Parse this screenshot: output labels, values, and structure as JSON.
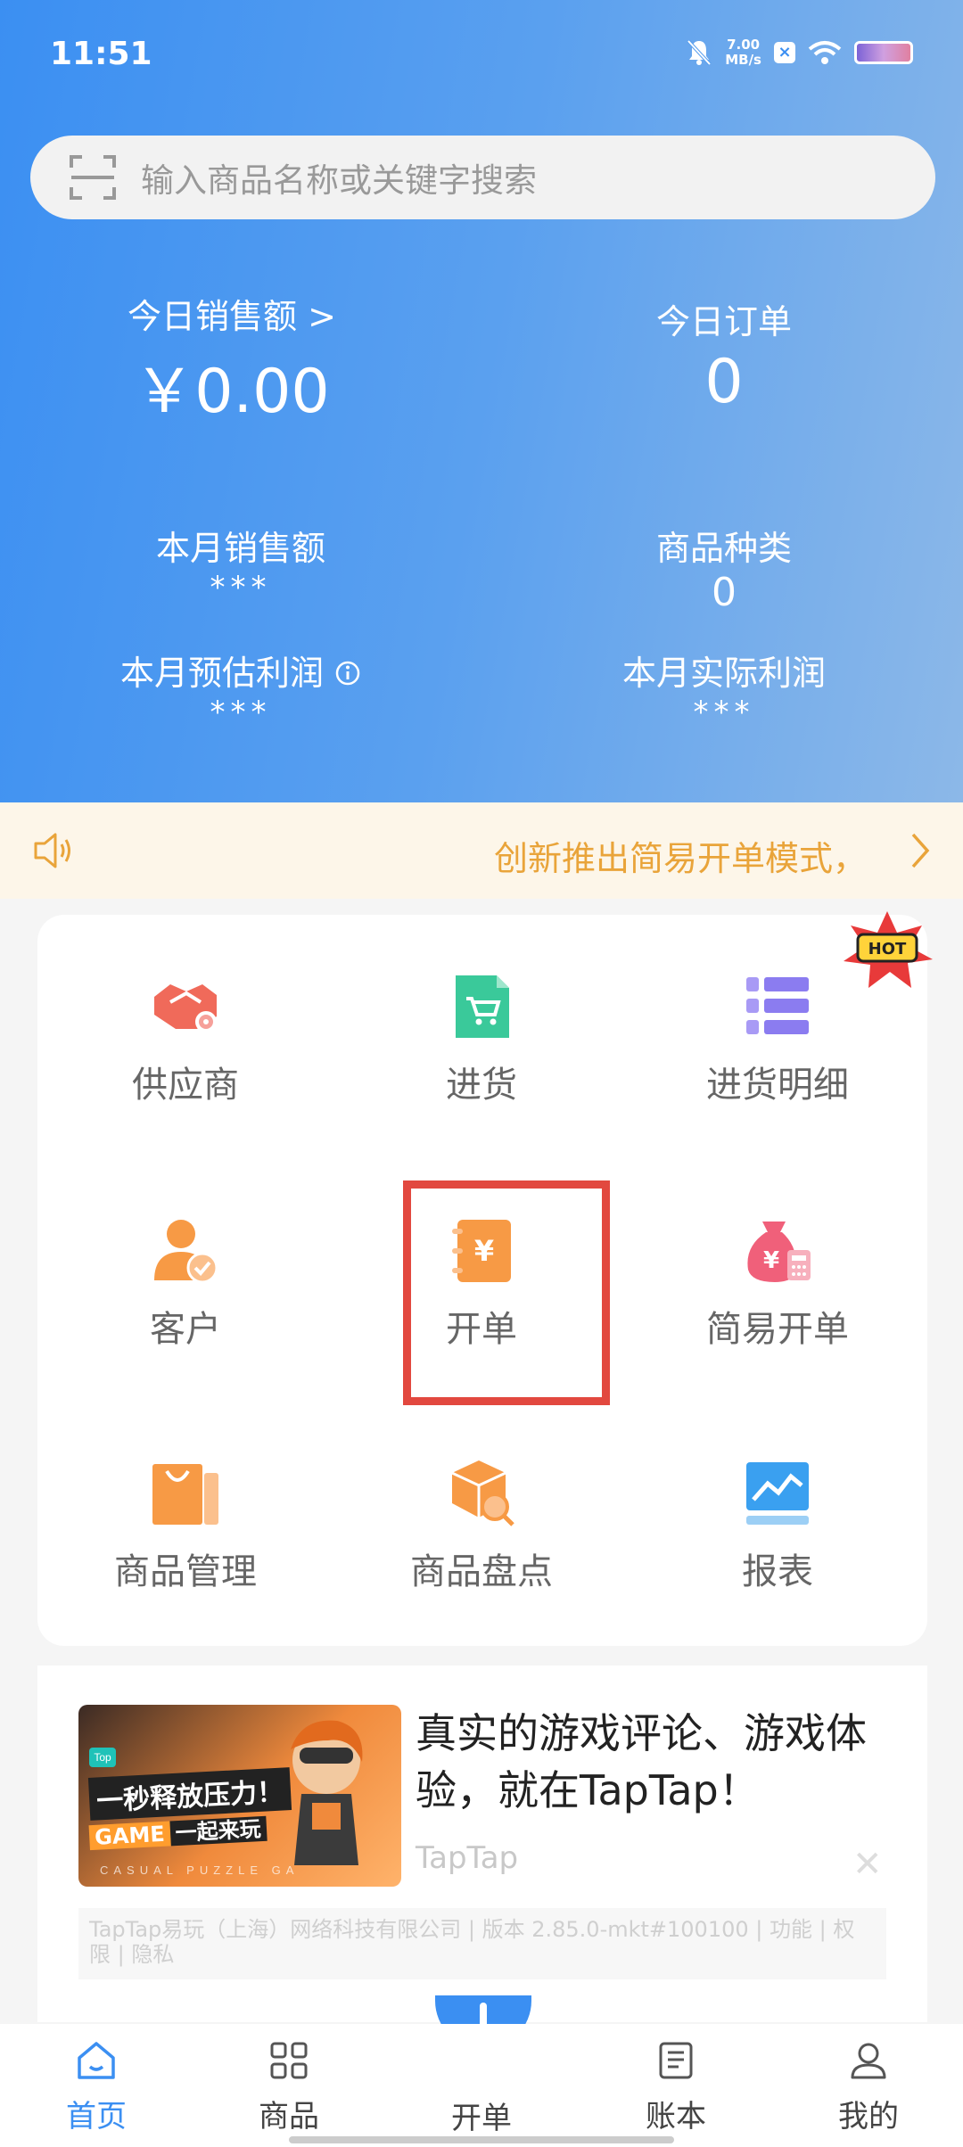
{
  "status_bar": {
    "time": "11:51",
    "net_speed_value": "7.00",
    "net_speed_unit": "MB/s"
  },
  "search": {
    "placeholder": "输入商品名称或关键字搜索"
  },
  "stats": {
    "today_sales_label": "今日销售额",
    "today_sales_arrow": ">",
    "today_sales_value": "￥0.00",
    "today_orders_label": "今日订单",
    "today_orders_value": "0",
    "month_sales_label": "本月销售额",
    "month_sales_value": "***",
    "product_types_label": "商品种类",
    "product_types_value": "0",
    "month_est_profit_label": "本月预估利润",
    "month_est_profit_value": "***",
    "month_actual_profit_label": "本月实际利润",
    "month_actual_profit_value": "***"
  },
  "notice": {
    "text": "创新推出简易开单模式，"
  },
  "grid": {
    "items": [
      {
        "label": "供应商",
        "icon": "handshake-icon",
        "color": "#f06a5a"
      },
      {
        "label": "进货",
        "icon": "cart-doc-icon",
        "color": "#3ac99a"
      },
      {
        "label": "进货明细",
        "icon": "list-icon",
        "color": "#8b7cf0"
      },
      {
        "label": "客户",
        "icon": "user-check-icon",
        "color": "#f79a45"
      },
      {
        "label": "开单",
        "icon": "yen-notebook-icon",
        "color": "#f79a45"
      },
      {
        "label": "简易开单",
        "icon": "money-bag-icon",
        "color": "#f0607a"
      },
      {
        "label": "商品管理",
        "icon": "shopping-bag-icon",
        "color": "#f79a45"
      },
      {
        "label": "商品盘点",
        "icon": "box-search-icon",
        "color": "#f79a45"
      },
      {
        "label": "报表",
        "icon": "chart-icon",
        "color": "#3aa0f0"
      }
    ]
  },
  "ad": {
    "image_tag": "Top",
    "image_line1": "一秒释放压力！",
    "image_line2_game": "GAME",
    "image_line2_rest": "一起来玩",
    "image_bottom": "CASUAL PUZZLE GA",
    "title": "真实的游戏评论、游戏体验，就在TapTap！",
    "source": "TapTap",
    "close": "✕",
    "footer": "TapTap易玩（上海）网络科技有限公司 | 版本 2.85.0-mkt#100100 | 功能 | 权限 | 隐私"
  },
  "bottom_nav": {
    "items": [
      {
        "label": "首页"
      },
      {
        "label": "商品"
      },
      {
        "label": "开单"
      },
      {
        "label": "账本"
      },
      {
        "label": "我的"
      }
    ]
  },
  "colors": {
    "primary": "#3b8ff2",
    "notice_text": "#e9a43a",
    "highlight": "#e2483f"
  }
}
